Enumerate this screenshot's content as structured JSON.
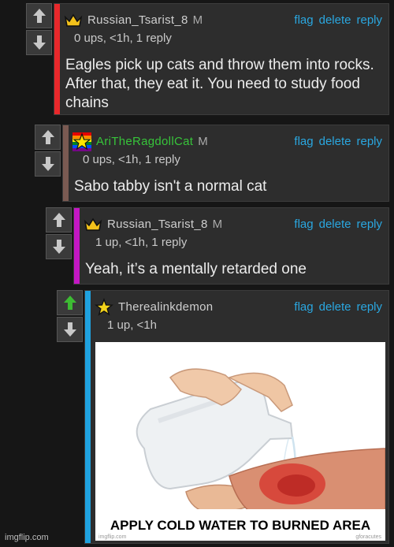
{
  "actions": {
    "flag": "flag",
    "delete": "delete",
    "reply": "reply"
  },
  "comments": [
    {
      "username": "Russian_Tsarist_8",
      "mod": "M",
      "meta": "0 ups, <1h, 1 reply",
      "text": "Eagles pick up cats and throw them into rocks. After that, they eat it. You need to study food chains",
      "accent": "#e8282b",
      "name_color": "#cfcfcf",
      "badge": "crown"
    },
    {
      "username": "AriTheRagdollCat",
      "mod": "M",
      "meta": "0 ups, <1h, 1 reply",
      "text": "Sabo tabby isn't a normal cat",
      "accent": "#7a5a52",
      "name_color": "#37c43a",
      "badge": "pride-star"
    },
    {
      "username": "Russian_Tsarist_8",
      "mod": "M",
      "meta": "1 up, <1h, 1 reply",
      "text": "Yeah, it’s a mentally retarded one",
      "accent": "#c417c4",
      "name_color": "#cfcfcf",
      "badge": "crown"
    },
    {
      "username": "Therealinkdemon",
      "meta": "1 up, <1h",
      "accent": "#1fa2e0",
      "name_color": "#cfcfcf",
      "badge": "star",
      "upvoted": true,
      "image": {
        "caption": "APPLY COLD WATER TO BURNED AREA",
        "small_watermark": "imgflip.com",
        "corner_tag": "gforacutes"
      }
    }
  ],
  "watermark": "imgflip.com",
  "colors": {
    "link": "#2aa7e0",
    "upvote_active": "#3dbb33",
    "vote_icon": "#c8c8c8"
  }
}
